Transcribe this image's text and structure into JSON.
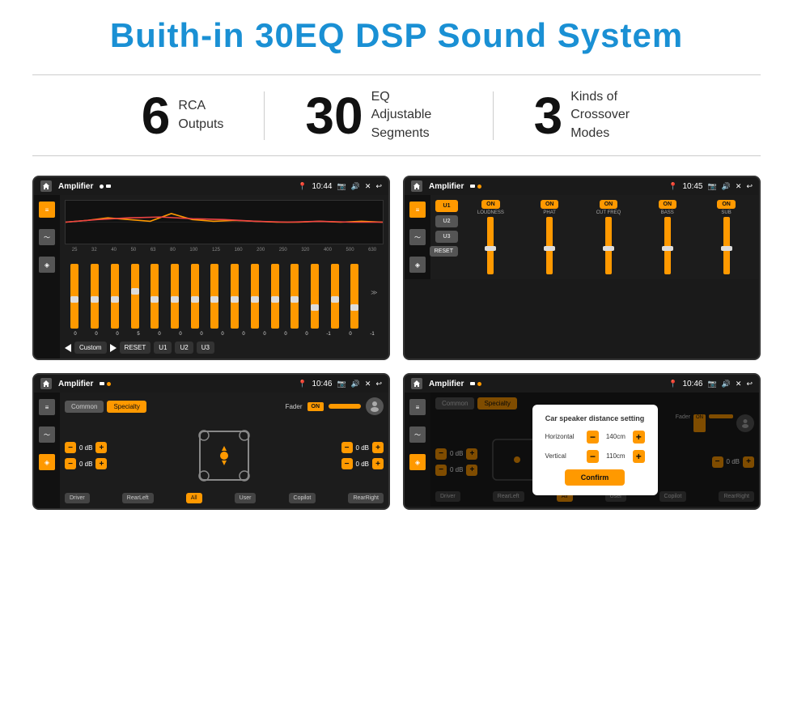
{
  "header": {
    "title": "Buith-in 30EQ DSP Sound System"
  },
  "stats": [
    {
      "number": "6",
      "label": "RCA\nOutputs"
    },
    {
      "number": "30",
      "label": "EQ Adjustable\nSegments"
    },
    {
      "number": "3",
      "label": "Kinds of\nCrossover Modes"
    }
  ],
  "screens": [
    {
      "id": "screen1",
      "statusTitle": "Amplifier",
      "time": "10:44",
      "type": "eq",
      "eqLabels": [
        "25",
        "32",
        "40",
        "50",
        "63",
        "80",
        "100",
        "125",
        "160",
        "200",
        "250",
        "320",
        "400",
        "500",
        "630"
      ],
      "eqValues": [
        "0",
        "0",
        "0",
        "5",
        "0",
        "0",
        "0",
        "0",
        "0",
        "0",
        "0",
        "0",
        "-1",
        "0",
        "-1"
      ],
      "eqButtonLabels": [
        "Custom",
        "RESET",
        "U1",
        "U2",
        "U3"
      ]
    },
    {
      "id": "screen2",
      "statusTitle": "Amplifier",
      "time": "10:45",
      "type": "channels",
      "channelButtons": [
        "U1",
        "U2",
        "U3"
      ],
      "channelNames": [
        "LOUDNESS",
        "PHAT",
        "CUT FREQ",
        "BASS",
        "SUB"
      ],
      "resetLabel": "RESET"
    },
    {
      "id": "screen3",
      "statusTitle": "Amplifier",
      "time": "10:46",
      "type": "speaker",
      "tabs": [
        "Common",
        "Specialty"
      ],
      "activeTab": "Specialty",
      "faderLabel": "Fader",
      "faderOnLabel": "ON",
      "volRows": [
        "0 dB",
        "0 dB",
        "0 dB",
        "0 dB"
      ],
      "bottomButtons": [
        "Driver",
        "RearLeft",
        "All",
        "User",
        "Copilot",
        "RearRight"
      ]
    },
    {
      "id": "screen4",
      "statusTitle": "Amplifier",
      "time": "10:46",
      "type": "dialog",
      "tabs": [
        "Common",
        "Specialty"
      ],
      "activeTab": "Specialty",
      "dialog": {
        "title": "Car speaker distance setting",
        "rows": [
          {
            "label": "Horizontal",
            "value": "140cm"
          },
          {
            "label": "Vertical",
            "value": "110cm"
          }
        ],
        "confirmLabel": "Confirm"
      },
      "bottomButtons": [
        "Driver",
        "RearLeft",
        "All",
        "User",
        "Copilot",
        "RearRight"
      ]
    }
  ],
  "colors": {
    "accent": "#f90",
    "titleBlue": "#1a90d4",
    "dark": "#1c1c1c"
  }
}
